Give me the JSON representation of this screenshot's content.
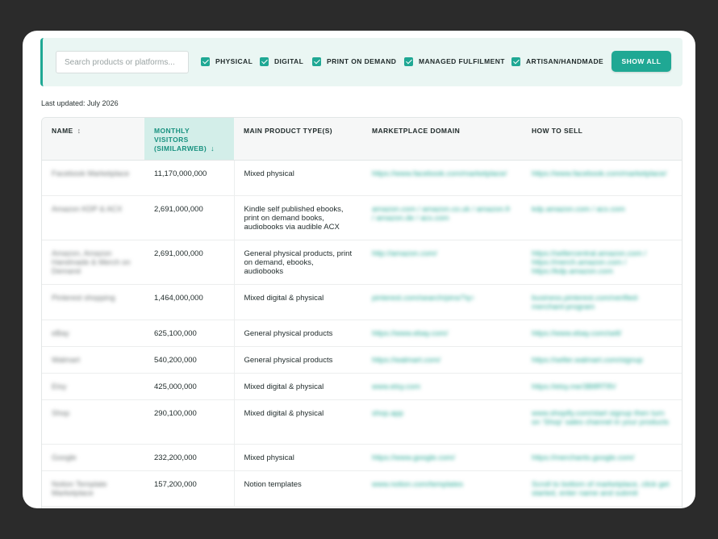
{
  "search": {
    "placeholder": "Search products or platforms..."
  },
  "filters": [
    {
      "label": "PHYSICAL",
      "checked": true
    },
    {
      "label": "DIGITAL",
      "checked": true
    },
    {
      "label": "PRINT ON DEMAND",
      "checked": true
    },
    {
      "label": "MANAGED FULFILMENT",
      "checked": true
    },
    {
      "label": "ARTISAN/HANDMADE",
      "checked": true
    }
  ],
  "show_all_label": "SHOW ALL",
  "last_updated": "Last updated: July 2026",
  "colors": {
    "accent": "#1fa894",
    "sorted_header_bg": "#d3eee9",
    "filter_bg": "#eaf6f3"
  },
  "table": {
    "headers": {
      "name": "NAME",
      "visitors": "MONTHLY VISITORS (SIMILARWEB)",
      "product_type": "MAIN PRODUCT TYPE(S)",
      "domain": "MARKETPLACE DOMAIN",
      "how_to_sell": "HOW TO SELL"
    },
    "sort_icon_name": "↕",
    "sort_desc_icon": "↓",
    "rows": [
      {
        "name": "Facebook Marketplace",
        "visitors": "11,170,000,000",
        "type": "Mixed physical",
        "domain": "https://www.facebook.com/marketplace/",
        "how": "https://www.facebook.com/marketplace/"
      },
      {
        "name": "Amazon KDP & ACX",
        "visitors": "2,691,000,000",
        "type": "Kindle self published ebooks, print on demand books, audiobooks via audible ACX",
        "domain": "amazon.com / amazon.co.uk / amazon.fr / amazon.de / acx.com",
        "how": "kdp.amazon.com / acx.com"
      },
      {
        "name": "Amazon, Amazon Handmade & Merch on Demand",
        "visitors": "2,691,000,000",
        "type": "General physical products, print on demand, ebooks, audiobooks",
        "domain": "http://amazon.com/",
        "how": "https://sellercentral.amazon.com / https://merch.amazon.com / https://kdp.amazon.com"
      },
      {
        "name": "Pinterest shopping",
        "visitors": "1,464,000,000",
        "type": "Mixed digital & physical",
        "domain": "pinterest.com/search/pins/?q=",
        "how": "business.pinterest.com/verified-merchant-program"
      },
      {
        "name": "eBay",
        "visitors": "625,100,000",
        "type": "General physical products",
        "domain": "https://www.ebay.com/",
        "how": "https://www.ebay.com/sell/"
      },
      {
        "name": "Walmart",
        "visitors": "540,200,000",
        "type": "General physical products",
        "domain": "https://walmart.com/",
        "how": "https://seller.walmart.com/signup"
      },
      {
        "name": "Etsy",
        "visitors": "425,000,000",
        "type": "Mixed digital & physical",
        "domain": "www.etsy.com",
        "how": "https://etsy.me/3B8RT8V"
      },
      {
        "name": "Shop",
        "visitors": "290,100,000",
        "type": "Mixed digital & physical",
        "domain": "shop.app",
        "how": "www.shopify.com/start signup then turn on 'Shop' sales channel in your products"
      },
      {
        "name": "Google",
        "visitors": "232,200,000",
        "type": "Mixed physical",
        "domain": "https://www.google.com/",
        "how": "https://merchants.google.com/"
      },
      {
        "name": "Notion Template Marketplace",
        "visitors": "157,200,000",
        "type": "Notion templates",
        "domain": "www.notion.com/templates",
        "how": "Scroll to bottom of marketplace, click get started, enter name and submit"
      }
    ]
  }
}
